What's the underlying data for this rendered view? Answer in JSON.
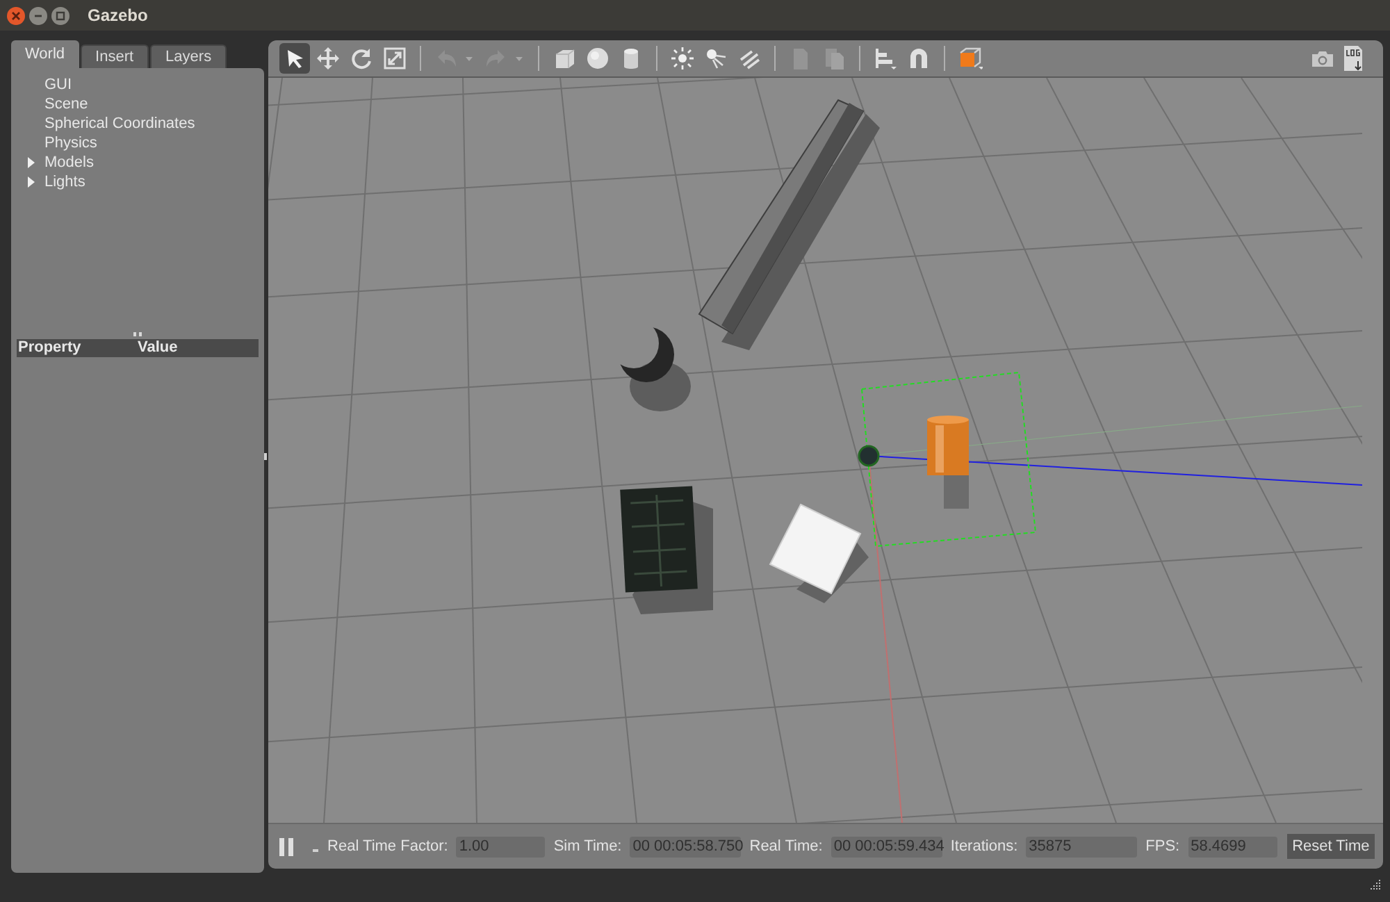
{
  "window": {
    "title": "Gazebo"
  },
  "tabs": [
    {
      "label": "World",
      "selected": true
    },
    {
      "label": "Insert",
      "selected": false
    },
    {
      "label": "Layers",
      "selected": false
    }
  ],
  "tree": [
    {
      "label": "GUI",
      "kind": "leaf"
    },
    {
      "label": "Scene",
      "kind": "leaf"
    },
    {
      "label": "Spherical Coordinates",
      "kind": "leaf"
    },
    {
      "label": "Physics",
      "kind": "leaf"
    },
    {
      "label": "Models",
      "kind": "group",
      "expanded": false
    },
    {
      "label": "Lights",
      "kind": "group",
      "expanded": false
    }
  ],
  "property_table": {
    "columns": [
      "Property",
      "Value"
    ]
  },
  "toolbar": {
    "tools": [
      {
        "kind": "select",
        "selected": true
      },
      {
        "kind": "translate",
        "selected": false
      },
      {
        "kind": "rotate",
        "selected": false
      },
      {
        "kind": "scale",
        "selected": false
      },
      {
        "kind": "sep"
      },
      {
        "kind": "undo",
        "disabled": true
      },
      {
        "kind": "redo",
        "disabled": true
      },
      {
        "kind": "sep"
      },
      {
        "kind": "box"
      },
      {
        "kind": "sphere"
      },
      {
        "kind": "cylinder"
      },
      {
        "kind": "sep"
      },
      {
        "kind": "pointlight"
      },
      {
        "kind": "spotlight"
      },
      {
        "kind": "dirlight"
      },
      {
        "kind": "sep"
      },
      {
        "kind": "copy",
        "disabled": true
      },
      {
        "kind": "paste",
        "disabled": true
      },
      {
        "kind": "sep"
      },
      {
        "kind": "align"
      },
      {
        "kind": "snap"
      },
      {
        "kind": "sep"
      },
      {
        "kind": "view"
      }
    ]
  },
  "status_bar": {
    "paused": false,
    "fields": [
      {
        "label": "Real Time Factor:",
        "value": "1.00"
      },
      {
        "label": "Sim Time:",
        "value": "00 00:05:58.750"
      },
      {
        "label": "Real Time:",
        "value": "00 00:05:59.434"
      },
      {
        "label": "Iterations:",
        "value": "35875"
      },
      {
        "label": "FPS:",
        "value": "58.4699"
      }
    ],
    "button": "Reset Time"
  }
}
